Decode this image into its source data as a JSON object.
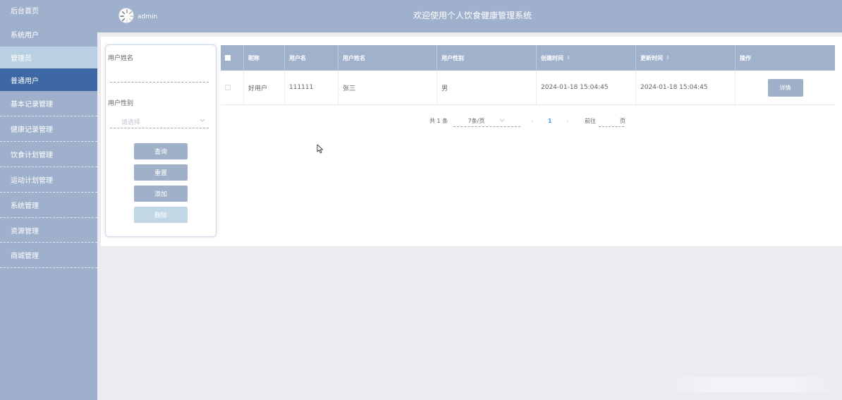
{
  "sidebar": {
    "items": [
      {
        "label": "后台首页"
      },
      {
        "label": "系统用户"
      },
      {
        "label": "管理员"
      },
      {
        "label": "普通用户"
      },
      {
        "label": "基本记录管理"
      },
      {
        "label": "健康记录管理"
      },
      {
        "label": "饮食计划管理"
      },
      {
        "label": "运动计划管理"
      },
      {
        "label": "系统管理"
      },
      {
        "label": "资源管理"
      },
      {
        "label": "商城管理"
      }
    ]
  },
  "header": {
    "user": "admin",
    "title": "欢迎使用个人饮食健康管理系统"
  },
  "search": {
    "name_label": "用户姓名",
    "gender_label": "用户性别",
    "gender_placeholder": "请选择",
    "query_button": "查询",
    "reset_button": "重置",
    "add_button": "添加",
    "delete_button": "删除"
  },
  "table": {
    "columns": [
      "昵称",
      "用户名",
      "用户姓名",
      "用户性别",
      "创建时间",
      "更新时间",
      "操作"
    ],
    "rows": [
      {
        "nickname": "好用户",
        "username": "111111",
        "real_name": "张三",
        "gender": "男",
        "created": "2024-01-18 15:04:45",
        "updated": "2024-01-18 15:04:45",
        "action": "详情"
      }
    ]
  },
  "pagination": {
    "total": "共 1 条",
    "page_size": "7条/页",
    "current_page": "1",
    "goto_label": "前往",
    "page_unit": "页"
  },
  "icons": {
    "avatar": "avatar-icon",
    "sort": "sort-icon",
    "chevron": "chevron-down-icon",
    "cursor": "mouse-cursor-icon"
  },
  "colors": {
    "sidebar_bg": "#9fb0cc",
    "active_item": "#3e68a4",
    "sub_item": "#b9d0e2",
    "button": "#a0b0c9",
    "pager_current": "#409eff"
  }
}
